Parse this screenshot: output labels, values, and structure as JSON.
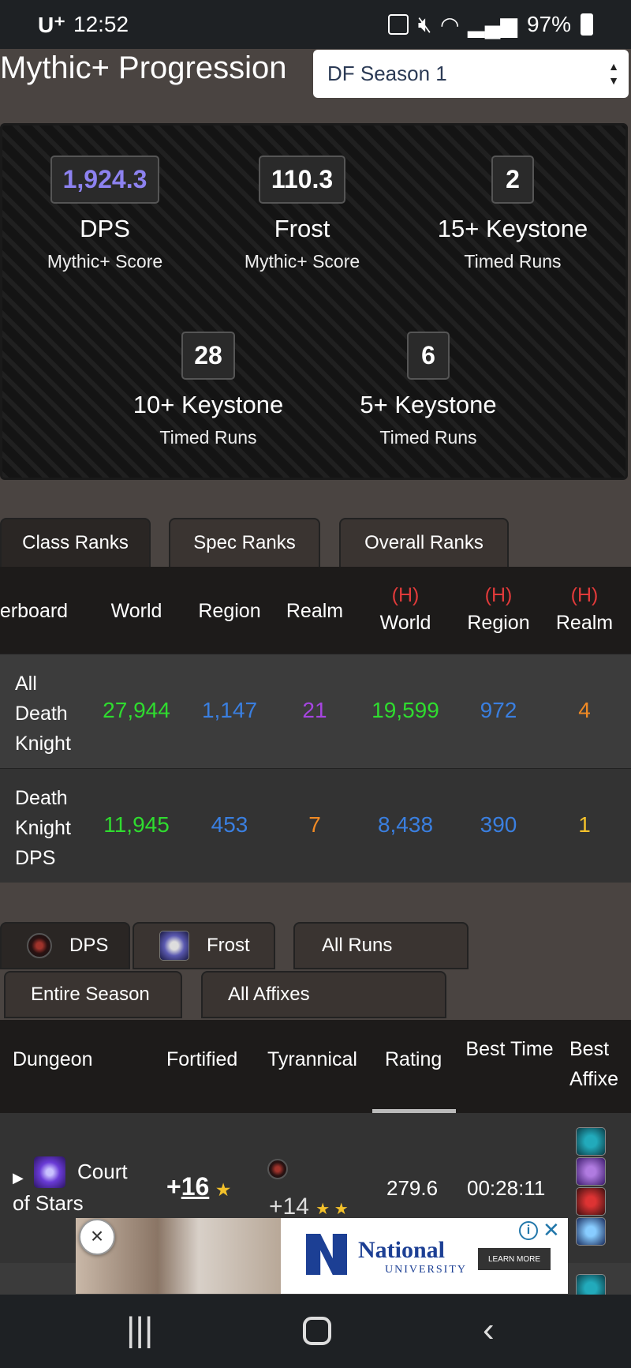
{
  "status_bar": {
    "carrier": "U⁺",
    "time": "12:52",
    "battery": "97%"
  },
  "header": {
    "title": "Mythic+ Progression",
    "season": "DF Season 1"
  },
  "scores": [
    {
      "value": "1,924.3",
      "label": "DPS",
      "sub": "Mythic+ Score"
    },
    {
      "value": "110.3",
      "label": "Frost",
      "sub": "Mythic+ Score"
    },
    {
      "value": "2",
      "label": "15+ Keystone",
      "sub": "Timed Runs"
    },
    {
      "value": "28",
      "label": "10+ Keystone",
      "sub": "Timed Runs"
    },
    {
      "value": "6",
      "label": "5+ Keystone",
      "sub": "Timed Runs"
    }
  ],
  "rank_tabs": [
    "Class Ranks",
    "Spec Ranks",
    "Overall Ranks"
  ],
  "rank_table": {
    "headers": [
      "erboard",
      "World",
      "Region",
      "Realm"
    ],
    "hardcore_marker": "(H)",
    "hardcore_headers": [
      "World",
      "Region",
      "Realm"
    ],
    "rows": [
      {
        "name": "All Death Knight",
        "values": [
          "27,944",
          "1,147",
          "21",
          "19,599",
          "972",
          "4"
        ]
      },
      {
        "name": "Death Knight DPS",
        "values": [
          "11,945",
          "453",
          "7",
          "8,438",
          "390",
          "1"
        ]
      }
    ]
  },
  "run_filters": {
    "role": "DPS",
    "spec": "Frost",
    "runs": "All Runs",
    "period": "Entire Season",
    "affixes": "All Affixes"
  },
  "runs_table": {
    "headers": {
      "dungeon": "Dungeon",
      "fortified": "Fortified",
      "tyrannical": "Tyrannical",
      "rating": "Rating",
      "best_time": "Best Time",
      "best_affixes": "Best Affixe"
    },
    "rows": [
      {
        "dungeon": "Court of Stars",
        "fortified_prefix": "+",
        "fortified_level": "16",
        "fortified_stars": "★",
        "tyrannical": "+14",
        "tyrannical_stars": "★ ★",
        "rating": "279.6",
        "best_time": "00:28:11"
      }
    ]
  },
  "ad": {
    "title": "National",
    "subtitle": "UNIVERSITY",
    "cta": "LEARN MORE",
    "info_icon": "i",
    "close_icon": "✕",
    "close_x": "×"
  },
  "colors": {
    "green": "#2fdc2f",
    "blue": "#3a7fe0",
    "purple": "#a645e0",
    "orange": "#f08a24",
    "gold": "#f3c12b",
    "red": "#e03a3a"
  }
}
